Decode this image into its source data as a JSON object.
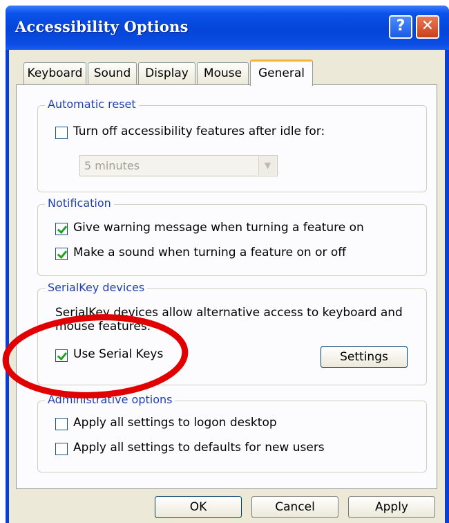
{
  "window": {
    "title": "Accessibility Options",
    "help_glyph": "?",
    "close_glyph": "✕"
  },
  "tabs": [
    {
      "label": "Keyboard",
      "active": false
    },
    {
      "label": "Sound",
      "active": false
    },
    {
      "label": "Display",
      "active": false
    },
    {
      "label": "Mouse",
      "active": false
    },
    {
      "label": "General",
      "active": true
    }
  ],
  "automatic_reset": {
    "legend": "Automatic reset",
    "checkbox_label": "Turn off accessibility features after idle for:",
    "checked": false,
    "idle_select_value": "5 minutes",
    "disabled": true
  },
  "notification": {
    "legend": "Notification",
    "items": [
      {
        "label": "Give warning message when turning a feature on",
        "checked": true
      },
      {
        "label": "Make a sound when turning a feature on or off",
        "checked": true
      }
    ]
  },
  "serialkey": {
    "legend": "SerialKey devices",
    "description_line1": "SerialKey devices allow alternative access to keyboard and",
    "description_line2": "mouse features.",
    "checkbox_label": "Use Serial Keys",
    "checked": true,
    "settings_label": "Settings"
  },
  "administrative": {
    "legend": "Administrative options",
    "items": [
      {
        "label": "Apply all settings to logon desktop",
        "checked": false
      },
      {
        "label": "Apply all settings to defaults for new users",
        "checked": false
      }
    ]
  },
  "footer": {
    "ok_label": "OK",
    "cancel_label": "Cancel",
    "apply_label": "Apply"
  },
  "colors": {
    "title_bar": "#0545d8",
    "group_legend": "#1f3fae",
    "active_tab_accent": "#f7b432",
    "annotation_circle": "#e00000"
  }
}
